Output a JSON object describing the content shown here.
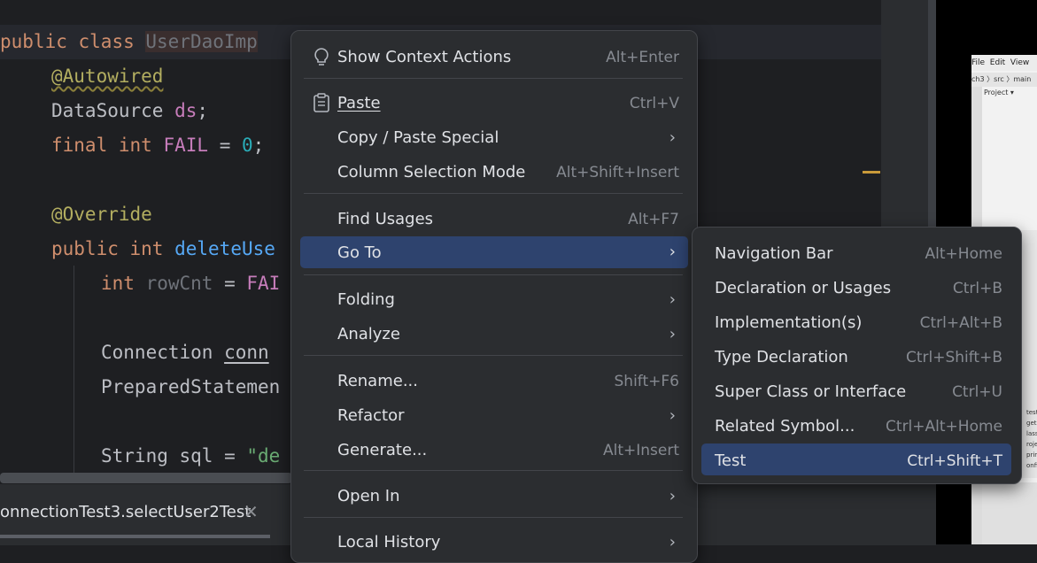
{
  "editor": {
    "line1": {
      "kw1": "public",
      "kw2": "class",
      "name": "UserDaoImp"
    },
    "line2": {
      "annotation": "@Autowired"
    },
    "line3": {
      "type": "DataSource",
      "field": "ds",
      "end": ";"
    },
    "line4": {
      "kw1": "final",
      "kw2": "int",
      "field": "FAIL",
      "eq": " = ",
      "num": "0",
      "end": ";"
    },
    "line5": {
      "annotation": "@Override"
    },
    "line6": {
      "kw1": "public",
      "kw2": "int",
      "fn": "deleteUse"
    },
    "line7": {
      "kw": "int",
      "var": "rowCnt",
      "eq": " = ",
      "field": "FAI"
    },
    "line8": {
      "type": "Connection",
      "var": "conn"
    },
    "line9": {
      "type": "PreparedStatemen"
    },
    "line10": {
      "type": "String",
      "var": "sql",
      "eq": " = ",
      "str": "\"de"
    }
  },
  "bottom_tab": {
    "label": "onnectionTest3.selectUser2Test",
    "close": "✕"
  },
  "context_menu": {
    "items": [
      {
        "label": "Show Context Actions",
        "shortcut": "Alt+Enter",
        "icon": "lightbulb-icon"
      },
      {
        "label": "Paste",
        "shortcut": "Ctrl+V",
        "icon": "clipboard-icon"
      },
      {
        "label": "Copy / Paste Special",
        "shortcut": "",
        "submenu": true
      },
      {
        "label": "Column Selection Mode",
        "shortcut": "Alt+Shift+Insert"
      },
      {
        "label": "Find Usages",
        "shortcut": "Alt+F7"
      },
      {
        "label": "Go To",
        "shortcut": "",
        "submenu": true,
        "selected": true
      },
      {
        "label": "Folding",
        "shortcut": "",
        "submenu": true
      },
      {
        "label": "Analyze",
        "shortcut": "",
        "submenu": true
      },
      {
        "label": "Rename...",
        "shortcut": "Shift+F6"
      },
      {
        "label": "Refactor",
        "shortcut": "",
        "submenu": true
      },
      {
        "label": "Generate...",
        "shortcut": "Alt+Insert"
      },
      {
        "label": "Open In",
        "shortcut": "",
        "submenu": true
      },
      {
        "label": "Local History",
        "shortcut": "",
        "submenu": true
      }
    ],
    "arrow": "›"
  },
  "goto_submenu": {
    "items": [
      {
        "label": "Navigation Bar",
        "shortcut": "Alt+Home"
      },
      {
        "label": "Declaration or Usages",
        "shortcut": "Ctrl+B"
      },
      {
        "label": "Implementation(s)",
        "shortcut": "Ctrl+Alt+B"
      },
      {
        "label": "Type Declaration",
        "shortcut": "Ctrl+Shift+B"
      },
      {
        "label": "Super Class or Interface",
        "shortcut": "Ctrl+U"
      },
      {
        "label": "Related Symbol...",
        "shortcut": "Ctrl+Alt+Home"
      },
      {
        "label": "Test",
        "shortcut": "Ctrl+Shift+T",
        "selected": true
      }
    ]
  },
  "mini_window": {
    "menu": "File  Edit  View",
    "crumb": "ch3 〉src 〉main",
    "project": "Project ▾",
    "side_label": "Project",
    "rows": "test\nget\nlasspa\nroject\npring\nonfig."
  },
  "colors": {
    "selection": "#2e436e",
    "menu_bg": "#2b2d30",
    "editor_bg": "#1e1f22"
  }
}
